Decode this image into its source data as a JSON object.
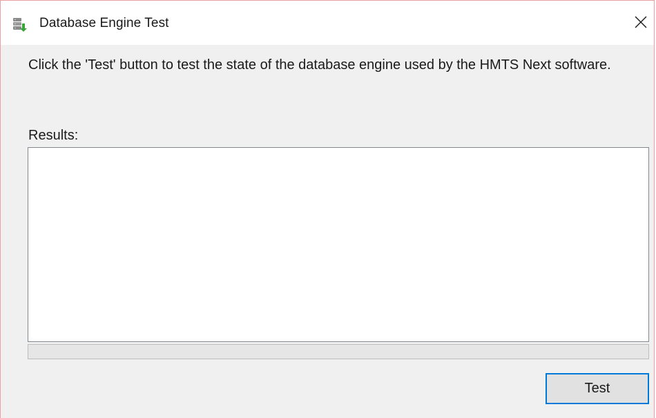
{
  "window": {
    "title": "Database Engine Test",
    "app_icon": "database-icon",
    "close_icon": "close-icon"
  },
  "main": {
    "description": "Click the 'Test' button to test the  state of the database engine used by the HMTS Next software.",
    "results_label": "Results:",
    "results_text": "",
    "progress": 0
  },
  "buttons": {
    "test_label": "Test"
  },
  "colors": {
    "accent": "#0078d7",
    "progress_fill": "#06b025",
    "window_border": "#e8a0a0"
  }
}
